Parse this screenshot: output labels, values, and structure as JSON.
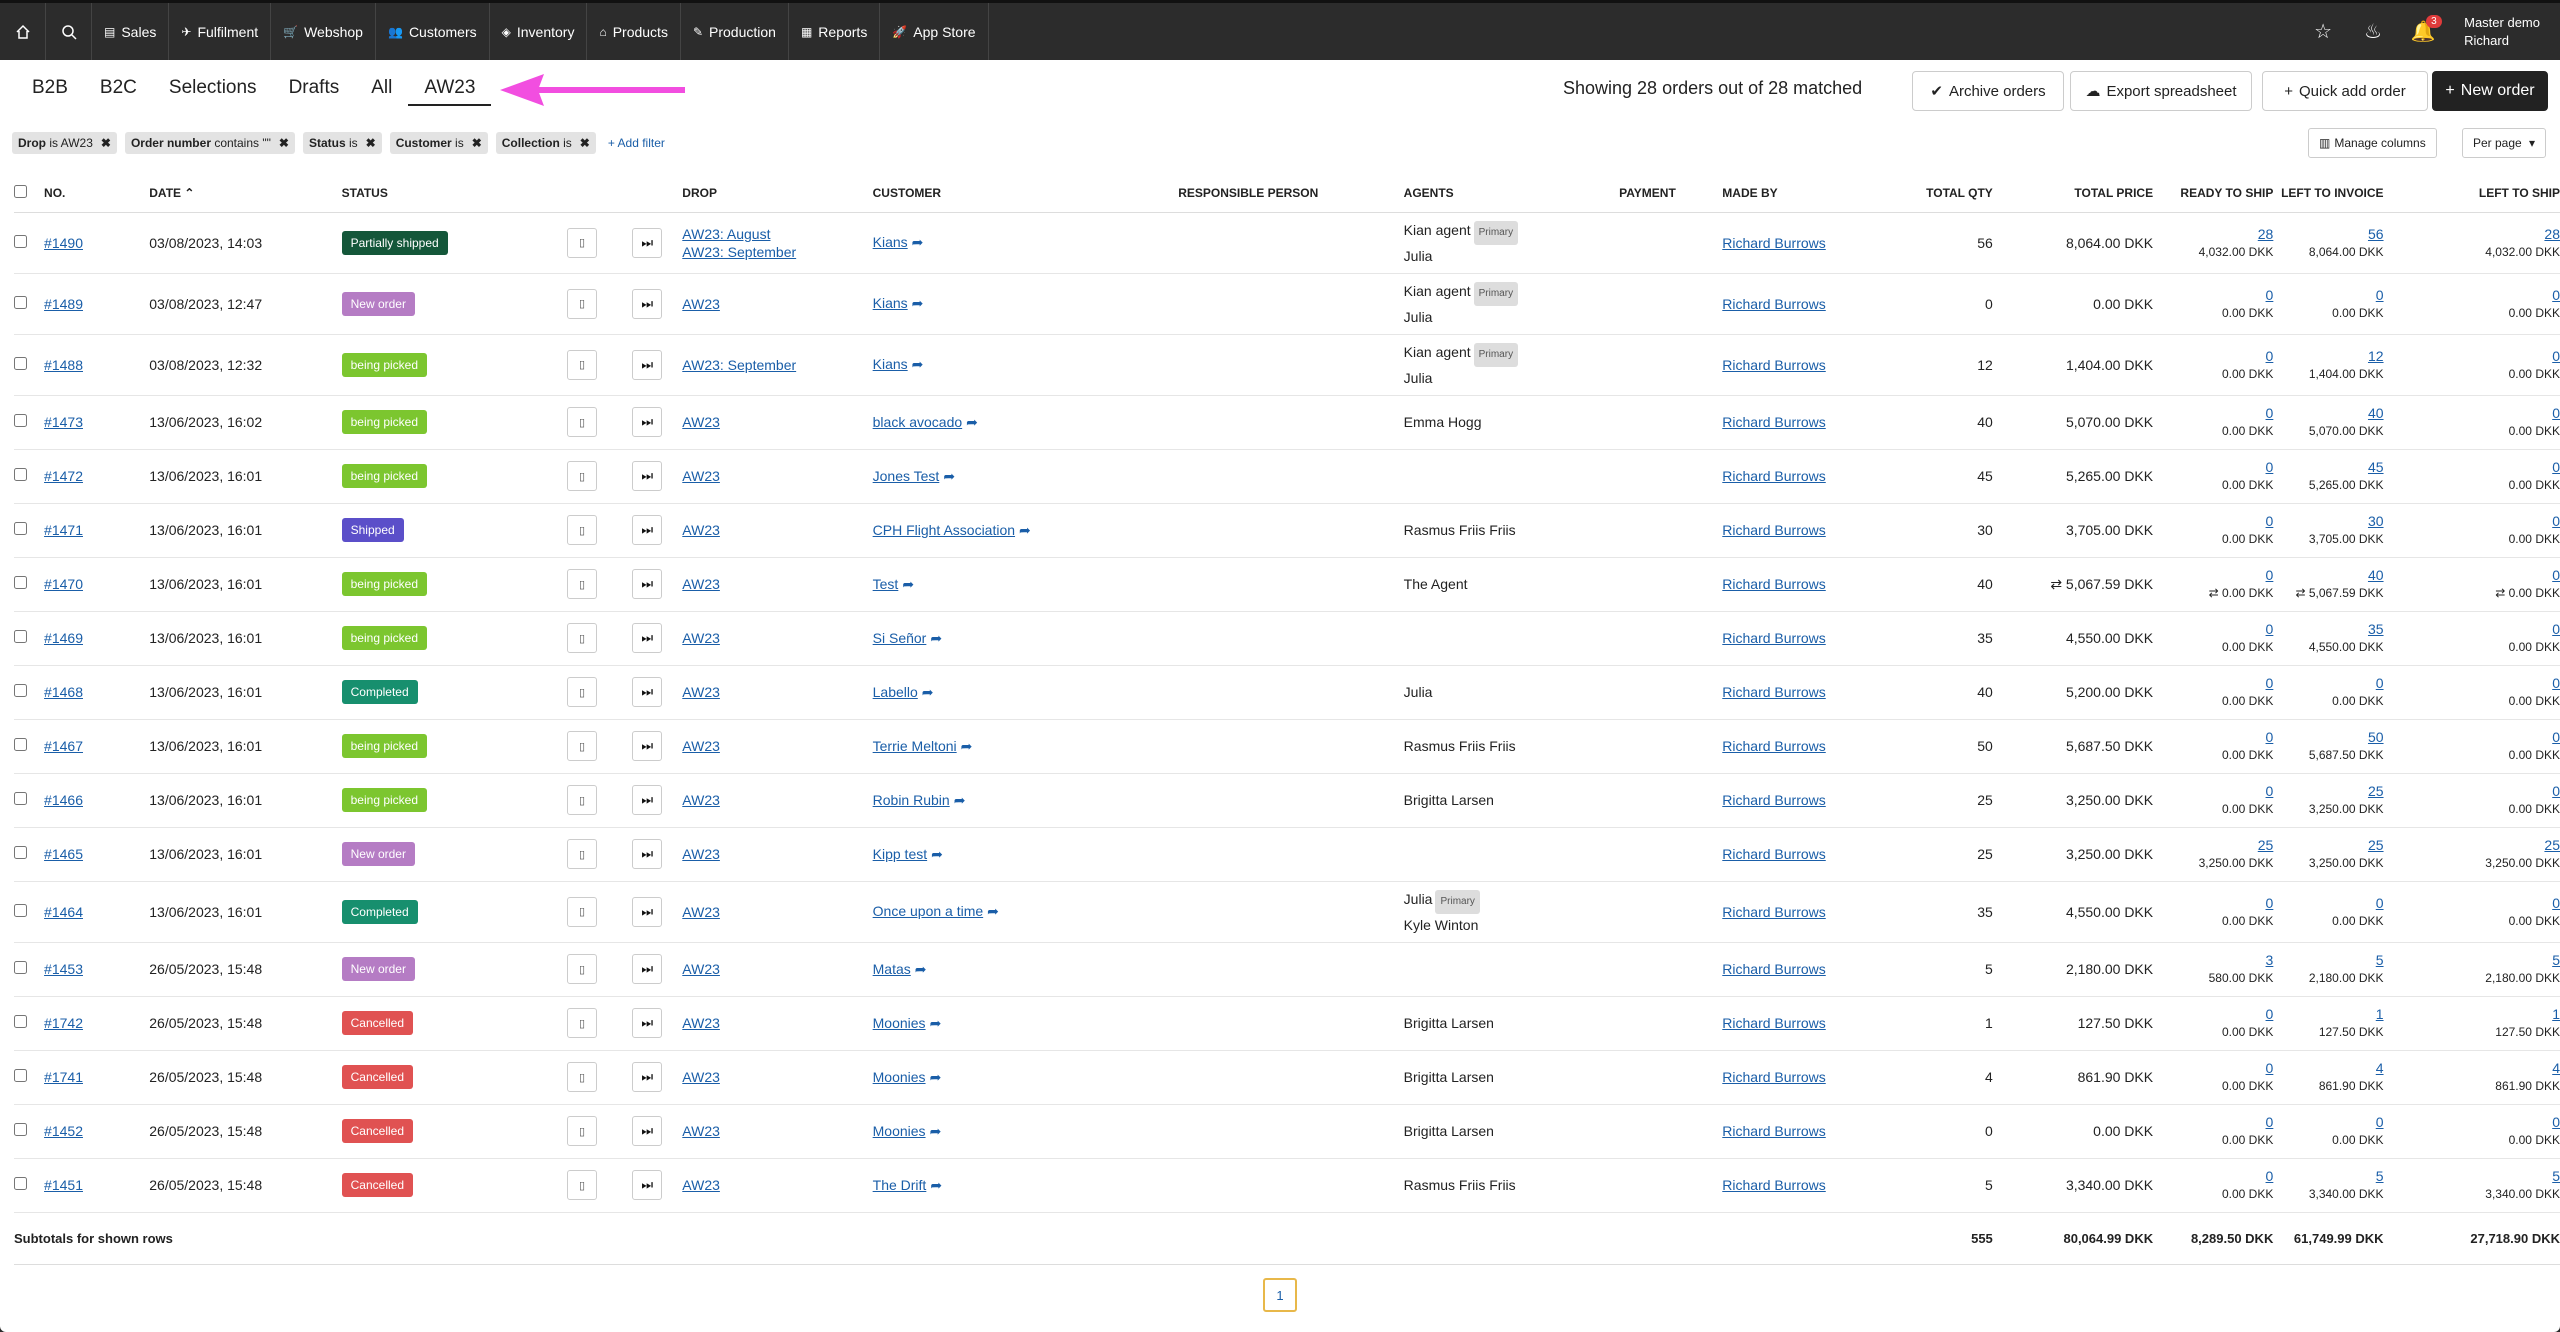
{
  "topnav": {
    "items": [
      {
        "label": "Sales",
        "icon": "document-icon"
      },
      {
        "label": "Fulfilment",
        "icon": "plane-icon"
      },
      {
        "label": "Webshop",
        "icon": "cart-icon"
      },
      {
        "label": "Customers",
        "icon": "users-icon"
      },
      {
        "label": "Inventory",
        "icon": "layers-icon"
      },
      {
        "label": "Products",
        "icon": "tag-icon"
      },
      {
        "label": "Production",
        "icon": "pencil-icon"
      },
      {
        "label": "Reports",
        "icon": "chart-icon"
      },
      {
        "label": "App Store",
        "icon": "rocket-icon"
      }
    ],
    "notification_count": "3",
    "user_line1": "Master demo",
    "user_line2": "Richard"
  },
  "tabs": [
    "B2B",
    "B2C",
    "Selections",
    "Drafts",
    "All",
    "AW23"
  ],
  "active_tab": "AW23",
  "showing_text": "Showing 28 orders out of 28 matched",
  "buttons": {
    "archive": "Archive orders",
    "export": "Export spreadsheet",
    "quick_add": "Quick add order",
    "new_order": "New order",
    "manage_columns": "Manage columns",
    "per_page": "Per page",
    "add_filter": "Add filter"
  },
  "filters": [
    {
      "bold": "Drop",
      "rest": " is AW23"
    },
    {
      "bold": "Order number",
      "rest": " contains \"\""
    },
    {
      "bold": "Status",
      "rest": " is"
    },
    {
      "bold": "Customer",
      "rest": " is"
    },
    {
      "bold": "Collection",
      "rest": " is"
    }
  ],
  "columns": [
    "No.",
    "Date",
    "Status",
    "",
    "",
    "Drop",
    "Customer",
    "Responsible person",
    "Agents",
    "Payment",
    "Made by",
    "Total qty",
    "Total price",
    "Ready to ship",
    "Left to invoice",
    "Left to ship"
  ],
  "status_colors": {
    "Partially shipped": "#14573a",
    "New order": "#b57cc4",
    "being picked": "#7cc62f",
    "Shipped": "#5b4fc9",
    "Completed": "#178f6e",
    "Cancelled": "#e05252"
  },
  "orders": [
    {
      "no": "#1490",
      "date": "03/08/2023, 14:03",
      "status": "Partially shipped",
      "drop": [
        "AW23: August",
        "AW23: September"
      ],
      "customer": "Kians",
      "agents": [
        {
          "name": "Kian agent",
          "primary": "Primary"
        },
        {
          "name": "Julia"
        }
      ],
      "made_by": "Richard Burrows",
      "qty": "56",
      "price": "8,064.00 DKK",
      "rts": [
        "28",
        "4,032.00 DKK"
      ],
      "lti": [
        "56",
        "8,064.00 DKK"
      ],
      "lts": [
        "28",
        "4,032.00 DKK"
      ],
      "tall": true
    },
    {
      "no": "#1489",
      "date": "03/08/2023, 12:47",
      "status": "New order",
      "drop": [
        "AW23"
      ],
      "customer": "Kians",
      "agents": [
        {
          "name": "Kian agent",
          "primary": "Primary"
        },
        {
          "name": "Julia"
        }
      ],
      "made_by": "Richard Burrows",
      "qty": "0",
      "price": "0.00 DKK",
      "rts": [
        "0",
        "0.00 DKK"
      ],
      "lti": [
        "0",
        "0.00 DKK"
      ],
      "lts": [
        "0",
        "0.00 DKK"
      ],
      "tall": true
    },
    {
      "no": "#1488",
      "date": "03/08/2023, 12:32",
      "status": "being picked",
      "drop": [
        "AW23: September"
      ],
      "customer": "Kians",
      "agents": [
        {
          "name": "Kian agent",
          "primary": "Primary"
        },
        {
          "name": "Julia"
        }
      ],
      "made_by": "Richard Burrows",
      "qty": "12",
      "price": "1,404.00 DKK",
      "rts": [
        "0",
        "0.00 DKK"
      ],
      "lti": [
        "12",
        "1,404.00 DKK"
      ],
      "lts": [
        "0",
        "0.00 DKK"
      ],
      "tall": true
    },
    {
      "no": "#1473",
      "date": "13/06/2023, 16:02",
      "status": "being picked",
      "drop": [
        "AW23"
      ],
      "customer": "black avocado",
      "agents": [
        {
          "name": "Emma Hogg"
        }
      ],
      "made_by": "Richard Burrows",
      "qty": "40",
      "price": "5,070.00 DKK",
      "rts": [
        "0",
        "0.00 DKK"
      ],
      "lti": [
        "40",
        "5,070.00 DKK"
      ],
      "lts": [
        "0",
        "0.00 DKK"
      ]
    },
    {
      "no": "#1472",
      "date": "13/06/2023, 16:01",
      "status": "being picked",
      "drop": [
        "AW23"
      ],
      "customer": "Jones Test",
      "agents": [],
      "made_by": "Richard Burrows",
      "qty": "45",
      "price": "5,265.00 DKK",
      "rts": [
        "0",
        "0.00 DKK"
      ],
      "lti": [
        "45",
        "5,265.00 DKK"
      ],
      "lts": [
        "0",
        "0.00 DKK"
      ]
    },
    {
      "no": "#1471",
      "date": "13/06/2023, 16:01",
      "status": "Shipped",
      "drop": [
        "AW23"
      ],
      "customer": "CPH Flight Association",
      "agents": [
        {
          "name": "Rasmus Friis Friis"
        }
      ],
      "made_by": "Richard Burrows",
      "qty": "30",
      "price": "3,705.00 DKK",
      "rts": [
        "0",
        "0.00 DKK"
      ],
      "lti": [
        "30",
        "3,705.00 DKK"
      ],
      "lts": [
        "0",
        "0.00 DKK"
      ]
    },
    {
      "no": "#1470",
      "date": "13/06/2023, 16:01",
      "status": "being picked",
      "drop": [
        "AW23"
      ],
      "customer": "Test",
      "agents": [
        {
          "name": "The Agent"
        }
      ],
      "made_by": "Richard Burrows",
      "qty": "40",
      "price": "⇄ 5,067.59 DKK",
      "rts": [
        "0",
        "⇄ 0.00 DKK"
      ],
      "lti": [
        "40",
        "⇄ 5,067.59 DKK"
      ],
      "lts": [
        "0",
        "⇄ 0.00 DKK"
      ]
    },
    {
      "no": "#1469",
      "date": "13/06/2023, 16:01",
      "status": "being picked",
      "drop": [
        "AW23"
      ],
      "customer": "Si Señor",
      "agents": [],
      "made_by": "Richard Burrows",
      "qty": "35",
      "price": "4,550.00 DKK",
      "rts": [
        "0",
        "0.00 DKK"
      ],
      "lti": [
        "35",
        "4,550.00 DKK"
      ],
      "lts": [
        "0",
        "0.00 DKK"
      ]
    },
    {
      "no": "#1468",
      "date": "13/06/2023, 16:01",
      "status": "Completed",
      "drop": [
        "AW23"
      ],
      "customer": "Labello",
      "agents": [
        {
          "name": "Julia"
        }
      ],
      "made_by": "Richard Burrows",
      "qty": "40",
      "price": "5,200.00 DKK",
      "rts": [
        "0",
        "0.00 DKK"
      ],
      "lti": [
        "0",
        "0.00 DKK"
      ],
      "lts": [
        "0",
        "0.00 DKK"
      ]
    },
    {
      "no": "#1467",
      "date": "13/06/2023, 16:01",
      "status": "being picked",
      "drop": [
        "AW23"
      ],
      "customer": "Terrie Meltoni",
      "agents": [
        {
          "name": "Rasmus Friis Friis"
        }
      ],
      "made_by": "Richard Burrows",
      "qty": "50",
      "price": "5,687.50 DKK",
      "rts": [
        "0",
        "0.00 DKK"
      ],
      "lti": [
        "50",
        "5,687.50 DKK"
      ],
      "lts": [
        "0",
        "0.00 DKK"
      ]
    },
    {
      "no": "#1466",
      "date": "13/06/2023, 16:01",
      "status": "being picked",
      "drop": [
        "AW23"
      ],
      "customer": "Robin Rubin",
      "agents": [
        {
          "name": "Brigitta Larsen"
        }
      ],
      "made_by": "Richard Burrows",
      "qty": "25",
      "price": "3,250.00 DKK",
      "rts": [
        "0",
        "0.00 DKK"
      ],
      "lti": [
        "25",
        "3,250.00 DKK"
      ],
      "lts": [
        "0",
        "0.00 DKK"
      ]
    },
    {
      "no": "#1465",
      "date": "13/06/2023, 16:01",
      "status": "New order",
      "drop": [
        "AW23"
      ],
      "customer": "Kipp test",
      "agents": [],
      "made_by": "Richard Burrows",
      "qty": "25",
      "price": "3,250.00 DKK",
      "rts": [
        "25",
        "3,250.00 DKK"
      ],
      "lti": [
        "25",
        "3,250.00 DKK"
      ],
      "lts": [
        "25",
        "3,250.00 DKK"
      ]
    },
    {
      "no": "#1464",
      "date": "13/06/2023, 16:01",
      "status": "Completed",
      "drop": [
        "AW23"
      ],
      "customer": "Once upon a time",
      "agents": [
        {
          "name": "Julia",
          "primary": "Primary"
        },
        {
          "name": "Kyle Winton"
        }
      ],
      "made_by": "Richard Burrows",
      "qty": "35",
      "price": "4,550.00 DKK",
      "rts": [
        "0",
        "0.00 DKK"
      ],
      "lti": [
        "0",
        "0.00 DKK"
      ],
      "lts": [
        "0",
        "0.00 DKK"
      ],
      "tall": true
    },
    {
      "no": "#1453",
      "date": "26/05/2023, 15:48",
      "status": "New order",
      "drop": [
        "AW23"
      ],
      "customer": "Matas",
      "agents": [],
      "made_by": "Richard Burrows",
      "qty": "5",
      "price": "2,180.00 DKK",
      "rts": [
        "3",
        "580.00 DKK"
      ],
      "lti": [
        "5",
        "2,180.00 DKK"
      ],
      "lts": [
        "5",
        "2,180.00 DKK"
      ]
    },
    {
      "no": "#1742",
      "date": "26/05/2023, 15:48",
      "status": "Cancelled",
      "drop": [
        "AW23"
      ],
      "customer": "Moonies",
      "agents": [
        {
          "name": "Brigitta Larsen"
        }
      ],
      "made_by": "Richard Burrows",
      "qty": "1",
      "price": "127.50 DKK",
      "rts": [
        "0",
        "0.00 DKK"
      ],
      "lti": [
        "1",
        "127.50 DKK"
      ],
      "lts": [
        "1",
        "127.50 DKK"
      ]
    },
    {
      "no": "#1741",
      "date": "26/05/2023, 15:48",
      "status": "Cancelled",
      "drop": [
        "AW23"
      ],
      "customer": "Moonies",
      "agents": [
        {
          "name": "Brigitta Larsen"
        }
      ],
      "made_by": "Richard Burrows",
      "qty": "4",
      "price": "861.90 DKK",
      "rts": [
        "0",
        "0.00 DKK"
      ],
      "lti": [
        "4",
        "861.90 DKK"
      ],
      "lts": [
        "4",
        "861.90 DKK"
      ]
    },
    {
      "no": "#1452",
      "date": "26/05/2023, 15:48",
      "status": "Cancelled",
      "drop": [
        "AW23"
      ],
      "customer": "Moonies",
      "agents": [
        {
          "name": "Brigitta Larsen"
        }
      ],
      "made_by": "Richard Burrows",
      "qty": "0",
      "price": "0.00 DKK",
      "rts": [
        "0",
        "0.00 DKK"
      ],
      "lti": [
        "0",
        "0.00 DKK"
      ],
      "lts": [
        "0",
        "0.00 DKK"
      ]
    },
    {
      "no": "#1451",
      "date": "26/05/2023, 15:48",
      "status": "Cancelled",
      "drop": [
        "AW23"
      ],
      "customer": "The Drift",
      "agents": [
        {
          "name": "Rasmus Friis Friis"
        }
      ],
      "made_by": "Richard Burrows",
      "qty": "5",
      "price": "3,340.00 DKK",
      "rts": [
        "0",
        "0.00 DKK"
      ],
      "lti": [
        "5",
        "3,340.00 DKK"
      ],
      "lts": [
        "5",
        "3,340.00 DKK"
      ]
    }
  ],
  "subtotals": {
    "label": "Subtotals for shown rows",
    "qty": "555",
    "price": "80,064.99 DKK",
    "rts": "8,289.50 DKK",
    "lti": "61,749.99 DKK",
    "lts": "27,718.90 DKK"
  },
  "pagination": {
    "current": "1"
  }
}
